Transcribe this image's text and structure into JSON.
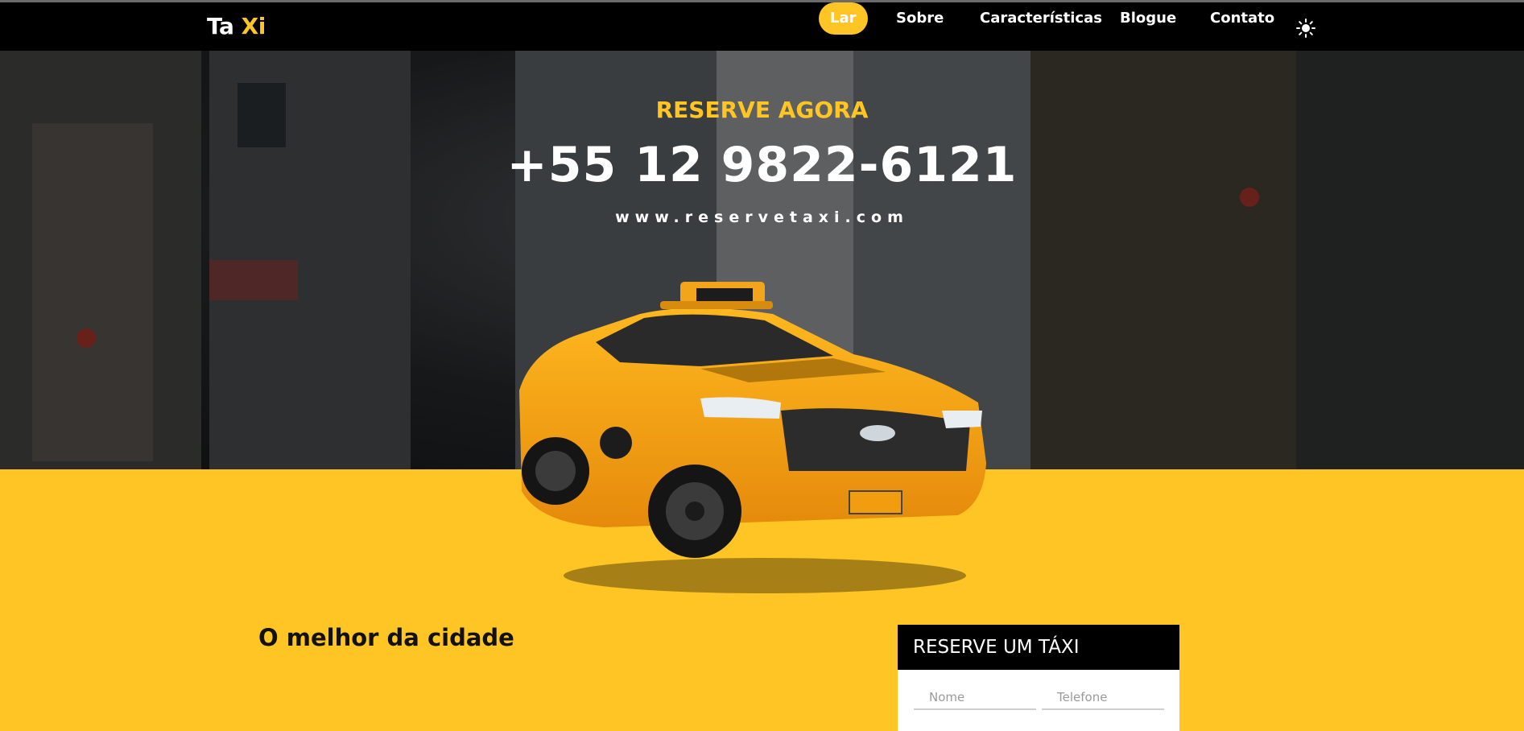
{
  "nav": {
    "logo_part1": "Ta",
    "logo_part2": "Xi",
    "items": [
      {
        "label": "Lar",
        "active": true
      },
      {
        "label": "Sobre",
        "active": false
      },
      {
        "label": "Características",
        "active": false
      },
      {
        "label": "Blogue",
        "active": false
      },
      {
        "label": "Contato",
        "active": false
      }
    ],
    "theme_icon": "sun-icon"
  },
  "hero": {
    "kicker": "RESERVE AGORA",
    "phone": "+55 12 9822-6121",
    "website": "www.reservetaxi.com",
    "image": "yellow-taxi-car"
  },
  "section": {
    "title": "O melhor da cidade"
  },
  "booking": {
    "title": "RESERVE UM TÁXI",
    "name_placeholder": "Nome",
    "phone_placeholder": "Telefone"
  },
  "colors": {
    "accent": "#ffc524",
    "navbar": "#000000",
    "text_dark": "#111111"
  }
}
